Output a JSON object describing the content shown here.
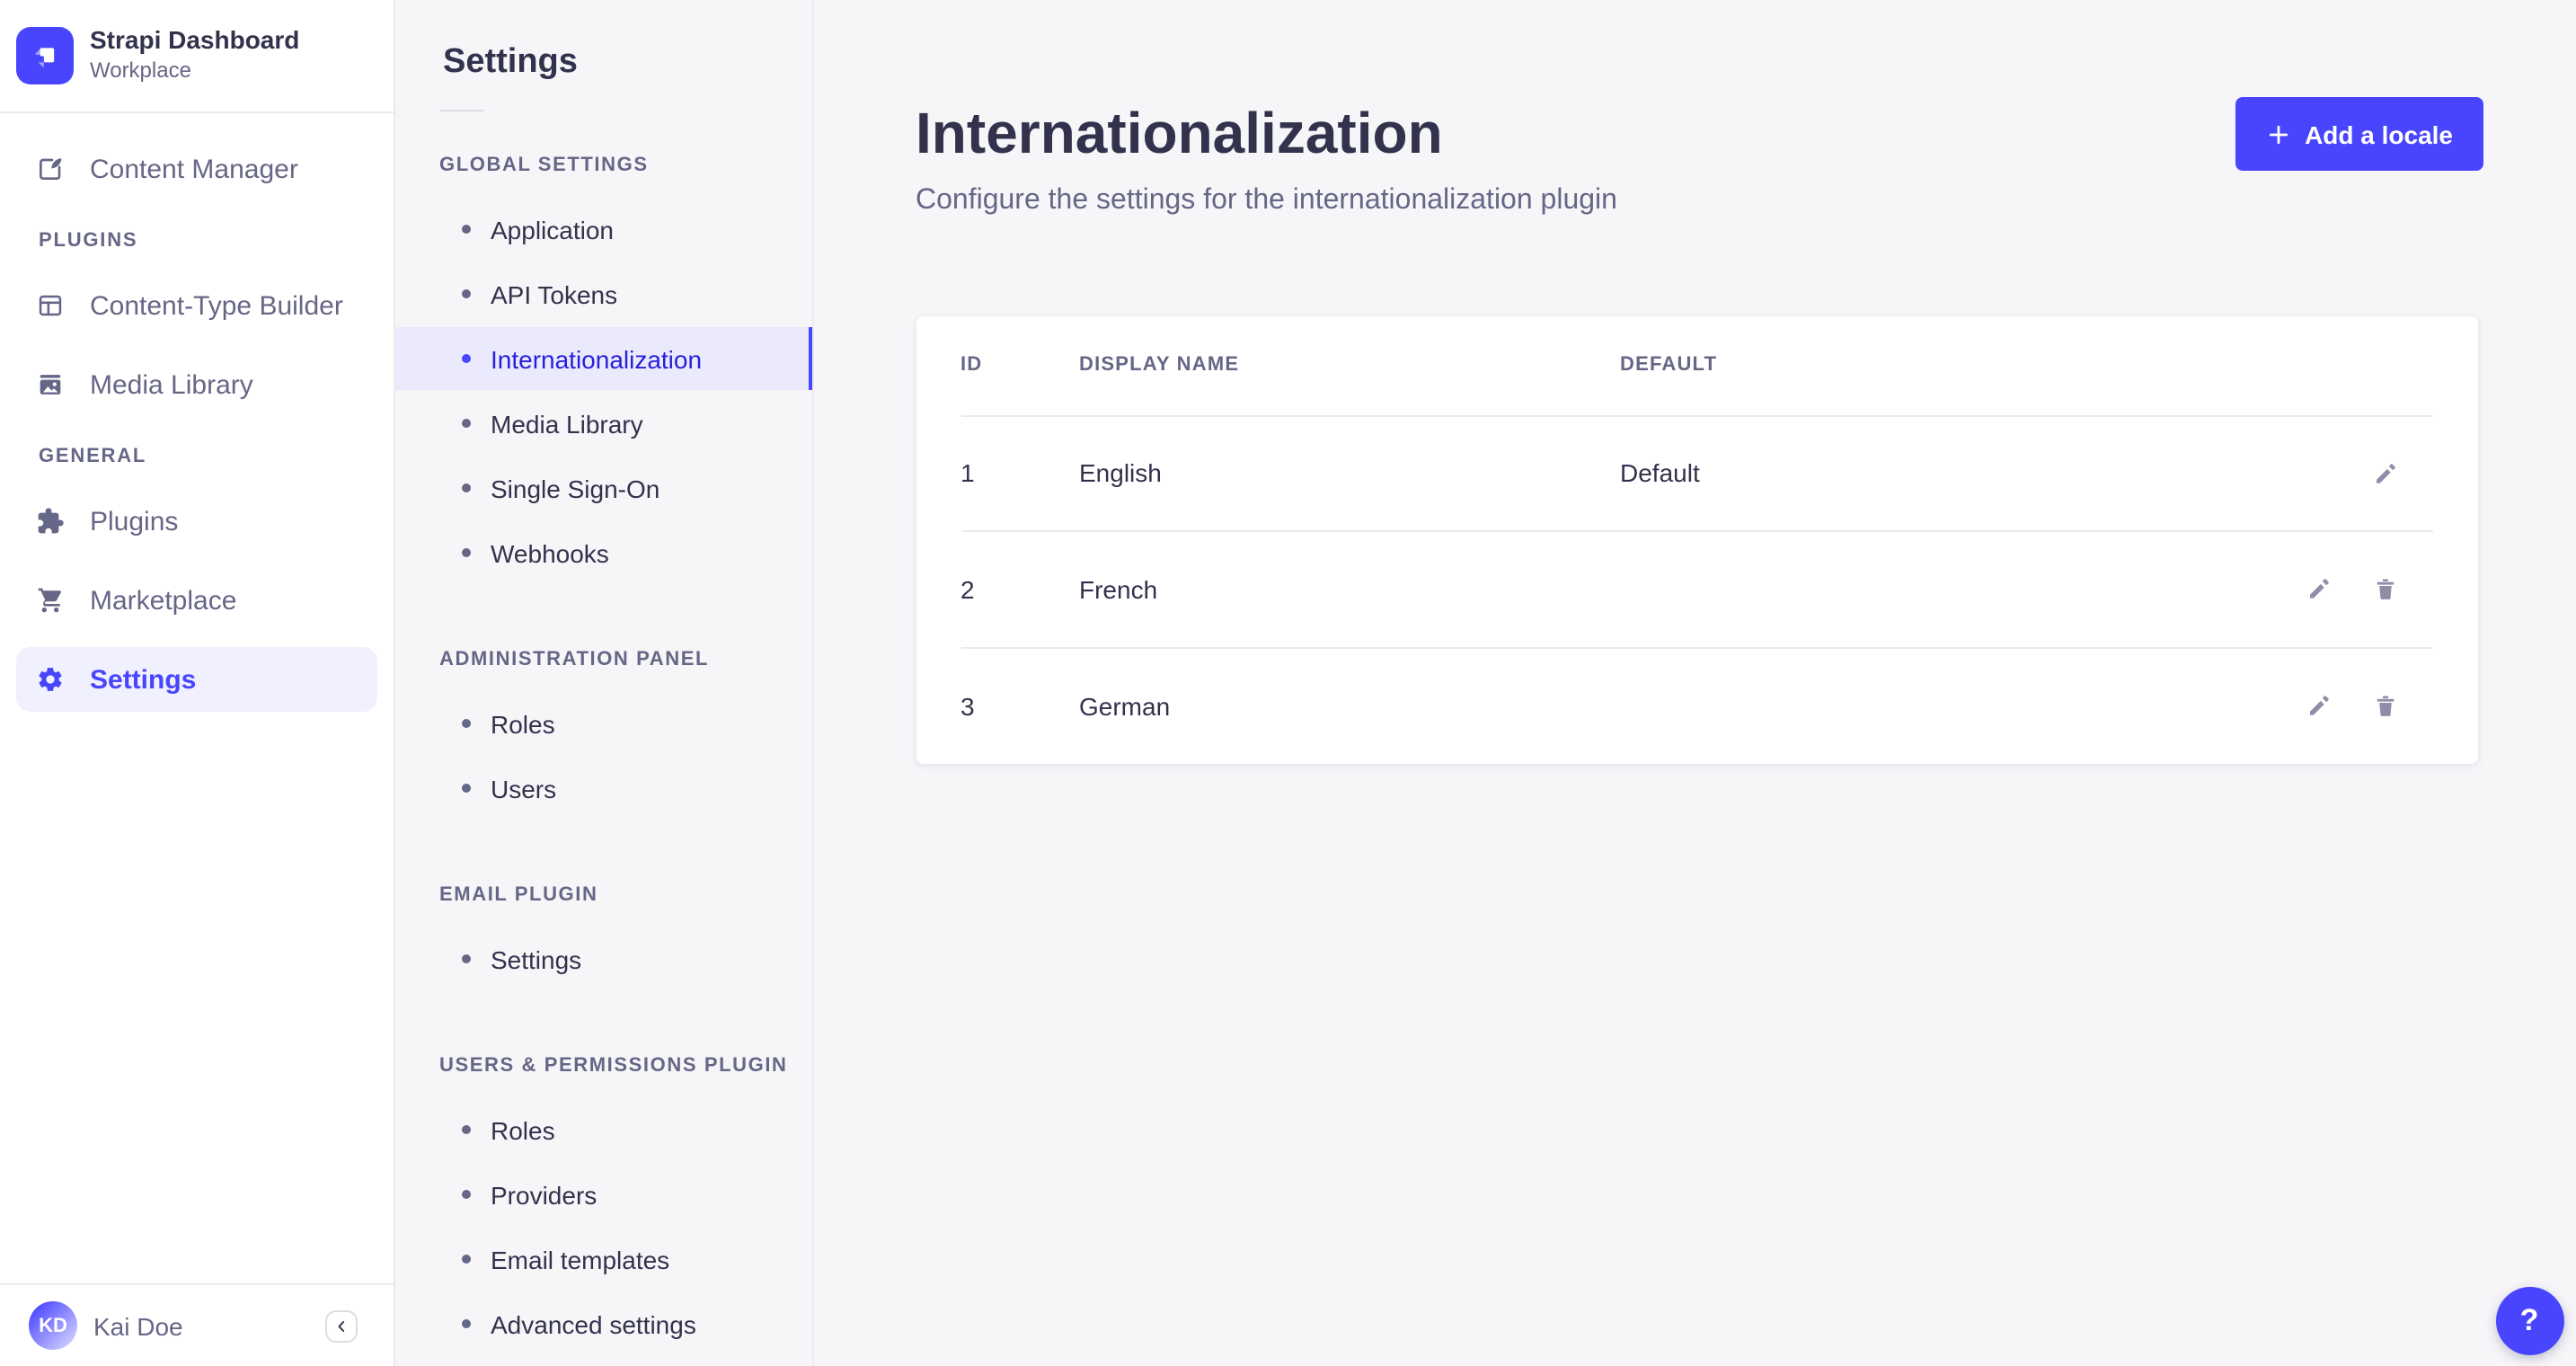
{
  "brand": {
    "title": "Strapi Dashboard",
    "subtitle": "Workplace"
  },
  "sidebar": {
    "top_items": [
      {
        "label": "Content Manager"
      }
    ],
    "sections": [
      {
        "label": "PLUGINS",
        "items": [
          {
            "label": "Content-Type Builder"
          },
          {
            "label": "Media Library"
          }
        ]
      },
      {
        "label": "GENERAL",
        "items": [
          {
            "label": "Plugins"
          },
          {
            "label": "Marketplace"
          },
          {
            "label": "Settings",
            "selected": true
          }
        ]
      }
    ],
    "user_name": "Kai Doe",
    "user_initials": "KD"
  },
  "subnav": {
    "title": "Settings",
    "sections": [
      {
        "label": "GLOBAL SETTINGS",
        "items": [
          "Application",
          "API Tokens",
          "Internationalization",
          "Media Library",
          "Single Sign-On",
          "Webhooks"
        ],
        "selected_item": "Internationalization"
      },
      {
        "label": "ADMINISTRATION PANEL",
        "items": [
          "Roles",
          "Users"
        ]
      },
      {
        "label": "EMAIL PLUGIN",
        "items": [
          "Settings"
        ]
      },
      {
        "label": "USERS & PERMISSIONS PLUGIN",
        "items": [
          "Roles",
          "Providers",
          "Email templates",
          "Advanced settings"
        ]
      }
    ]
  },
  "main": {
    "title": "Internationalization",
    "subtitle": "Configure the settings for the internationalization plugin",
    "add_button_label": "Add a locale",
    "table": {
      "columns": [
        "ID",
        "DISPLAY NAME",
        "DEFAULT"
      ],
      "rows": [
        {
          "id": "1",
          "display_name": "English",
          "default": "Default"
        },
        {
          "id": "2",
          "display_name": "French",
          "default": ""
        },
        {
          "id": "3",
          "display_name": "German",
          "default": ""
        }
      ]
    }
  },
  "help": {
    "label": "?"
  },
  "colors": {
    "primary": "#4945ff",
    "subnav_selected_bg": "#eaeafc",
    "subnav_selected_text": "#271fe0",
    "sidebar_selected_bg": "#f0f0ff",
    "text_dark": "#32324d",
    "text_gray": "#666687",
    "border": "#eaeaef",
    "page_bg": "#f6f6f9"
  }
}
